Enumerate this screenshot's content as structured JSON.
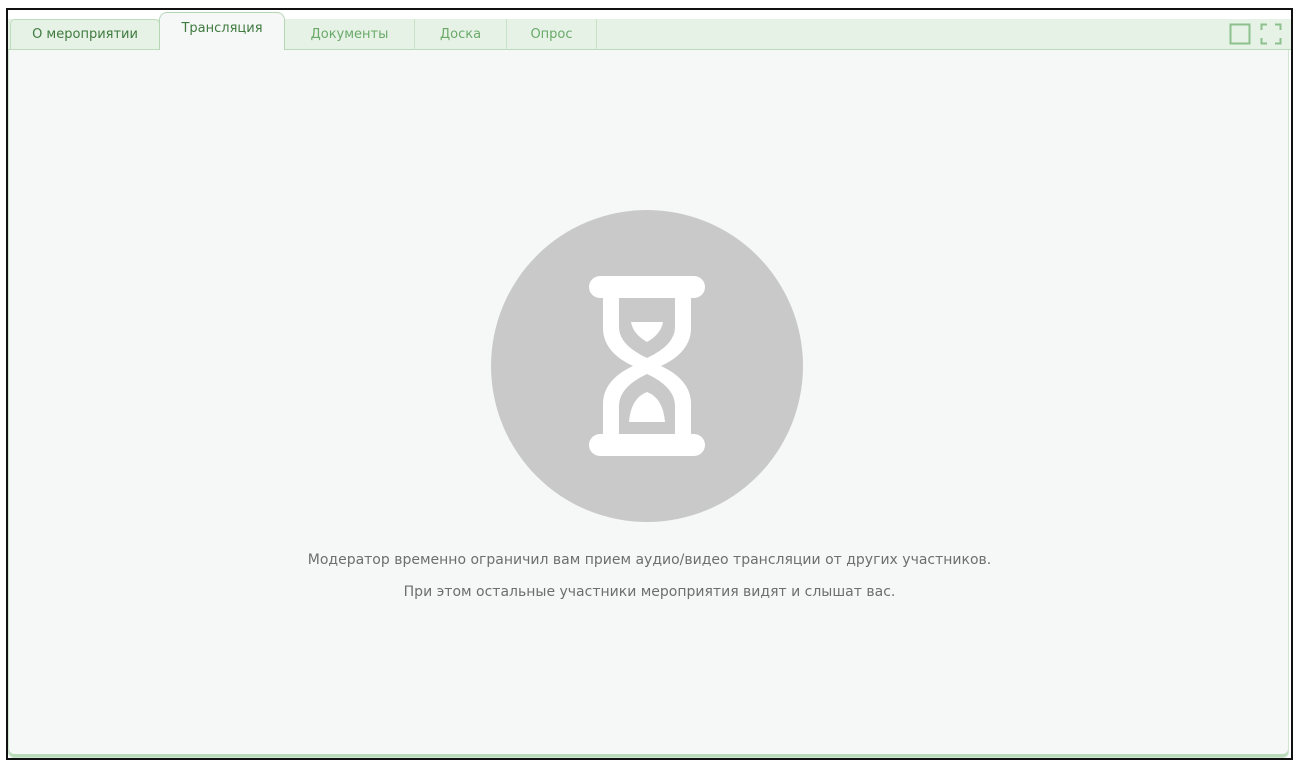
{
  "tabs": [
    {
      "label": "О мероприятии"
    },
    {
      "label": "Трансляция",
      "active": true
    },
    {
      "label": "Документы"
    },
    {
      "label": "Доска"
    },
    {
      "label": "Опрос"
    }
  ],
  "window_controls": {
    "restore_icon": "square-window-icon",
    "fullscreen_icon": "fullscreen-corners-icon"
  },
  "main": {
    "status_icon": "hourglass-icon",
    "message_line1": "Модератор временно ограничил вам прием аудио/видео трансляции от других участников.",
    "message_line2": "При этом остальные участники мероприятия видят и слышат вас."
  },
  "colors": {
    "accent": "#6aa96a",
    "tab_bar": "#e6f2e6",
    "content_bg": "#f6f8f7",
    "icon_circle": "#c9c9c9"
  }
}
